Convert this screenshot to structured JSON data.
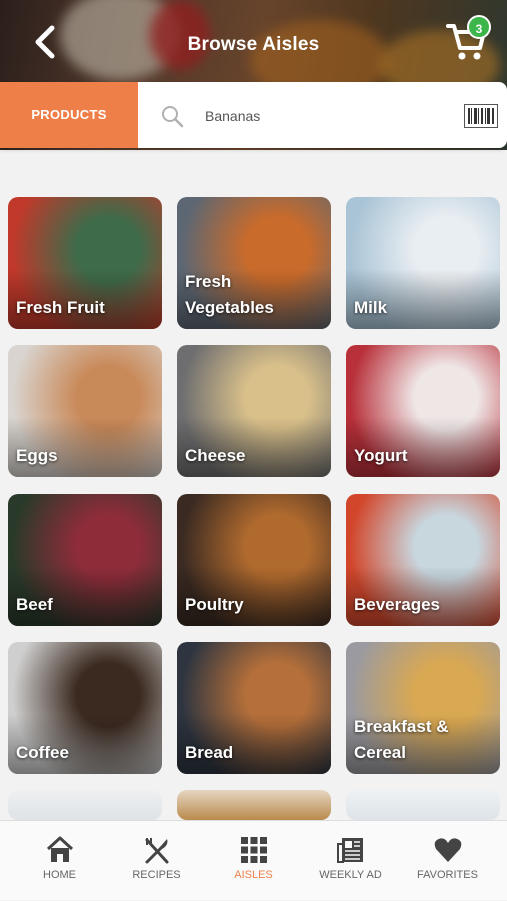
{
  "header": {
    "title": "Browse Aisles",
    "cart_count": "3"
  },
  "search": {
    "tab_label": "PRODUCTS",
    "value": "Bananas"
  },
  "aisles": [
    {
      "label": "Fresh Fruit",
      "c1": "#c0392b",
      "c2": "#3e6b4a"
    },
    {
      "label": "Fresh\nVegetables",
      "c1": "#5d6773",
      "c2": "#c96b2b"
    },
    {
      "label": "Milk",
      "c1": "#a9c4d6",
      "c2": "#e9eef2"
    },
    {
      "label": "Eggs",
      "c1": "#d9d4cf",
      "c2": "#c98a5a"
    },
    {
      "label": "Cheese",
      "c1": "#6e6e70",
      "c2": "#d9c08a"
    },
    {
      "label": "Yogurt",
      "c1": "#b8303a",
      "c2": "#efe6e6"
    },
    {
      "label": "Beef",
      "c1": "#2a3a2a",
      "c2": "#8e2c3a"
    },
    {
      "label": "Poultry",
      "c1": "#3a2a22",
      "c2": "#b06a2e"
    },
    {
      "label": "Beverages",
      "c1": "#d2472c",
      "c2": "#c8d6de"
    },
    {
      "label": "Coffee",
      "c1": "#cfcfcf",
      "c2": "#3b2a20"
    },
    {
      "label": "Bread",
      "c1": "#2e3540",
      "c2": "#b46f3a"
    },
    {
      "label": "Breakfast &\nCereal",
      "c1": "#9a9aa0",
      "c2": "#d9a852"
    }
  ],
  "partial_row": [
    {
      "c1": "#dfe3e6",
      "c2": "#eef0f2"
    },
    {
      "c1": "#b98a4c",
      "c2": "#e6d6c2"
    },
    {
      "c1": "#dde3e8",
      "c2": "#eef2f4"
    }
  ],
  "nav": [
    {
      "label": "HOME",
      "icon": "home-icon"
    },
    {
      "label": "RECIPES",
      "icon": "recipes-icon"
    },
    {
      "label": "AISLES",
      "icon": "aisles-icon",
      "active": true
    },
    {
      "label": "WEEKLY AD",
      "icon": "weekly-ad-icon"
    },
    {
      "label": "FAVORITES",
      "icon": "favorites-icon"
    }
  ],
  "colors": {
    "accent": "#ef7f49",
    "badge": "#3cb54a"
  }
}
